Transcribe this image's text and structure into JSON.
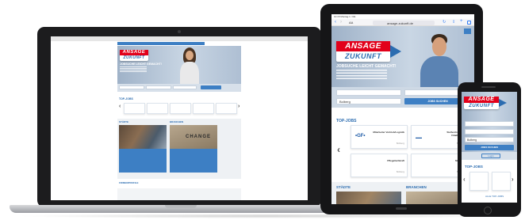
{
  "brand": {
    "logo_top": "ANSAGE",
    "logo_bottom": "ZUKUNFT",
    "accent_red": "#e2001a",
    "accent_blue": "#2b6cb0"
  },
  "laptop": {
    "hero_title": "JOBSUCHE LEICHT GEMACHT!",
    "section_top_jobs": "TOP-JOBS",
    "section_cities": "STÄDTE",
    "section_branches": "BRANCHEN",
    "branches_tile_word": "CHANGE",
    "section_bottom": "FIRMENPROFILE"
  },
  "tablet": {
    "status_time": "10:15 Montag 1. Okt.",
    "url": "ansage-zukunft.de",
    "tab_label": "AA",
    "hero_title": "JOBSUCHE LEICHT GEMACHT!",
    "location_value": "Bolberg",
    "search_button": "JOBS SUCHEN",
    "section_top_jobs": "TOP-JOBS",
    "section_cities": "STÄDTE",
    "section_branches": "BRANCHEN",
    "jobs": [
      {
        "logo": "•GF•",
        "title": "Mitarbeiter Vertrieb/Logistik",
        "sub": "Bolberg"
      },
      {
        "logo": "▬▬",
        "title": "Stellvertretende Filialleitung",
        "sub": "Bolberg"
      },
      {
        "logo": "",
        "title": "Pflegefachkraft",
        "sub": "Bolberg"
      },
      {
        "logo": "",
        "title": "Monteur",
        "sub": "Bolberg"
      }
    ]
  },
  "phone": {
    "location_value": "Bolberg",
    "search_button": "JOBS SUCHEN",
    "login_label": "Login",
    "section_top_jobs": "TOP-JOBS",
    "all_jobs_link": "ALLE TOP-JOBS"
  }
}
